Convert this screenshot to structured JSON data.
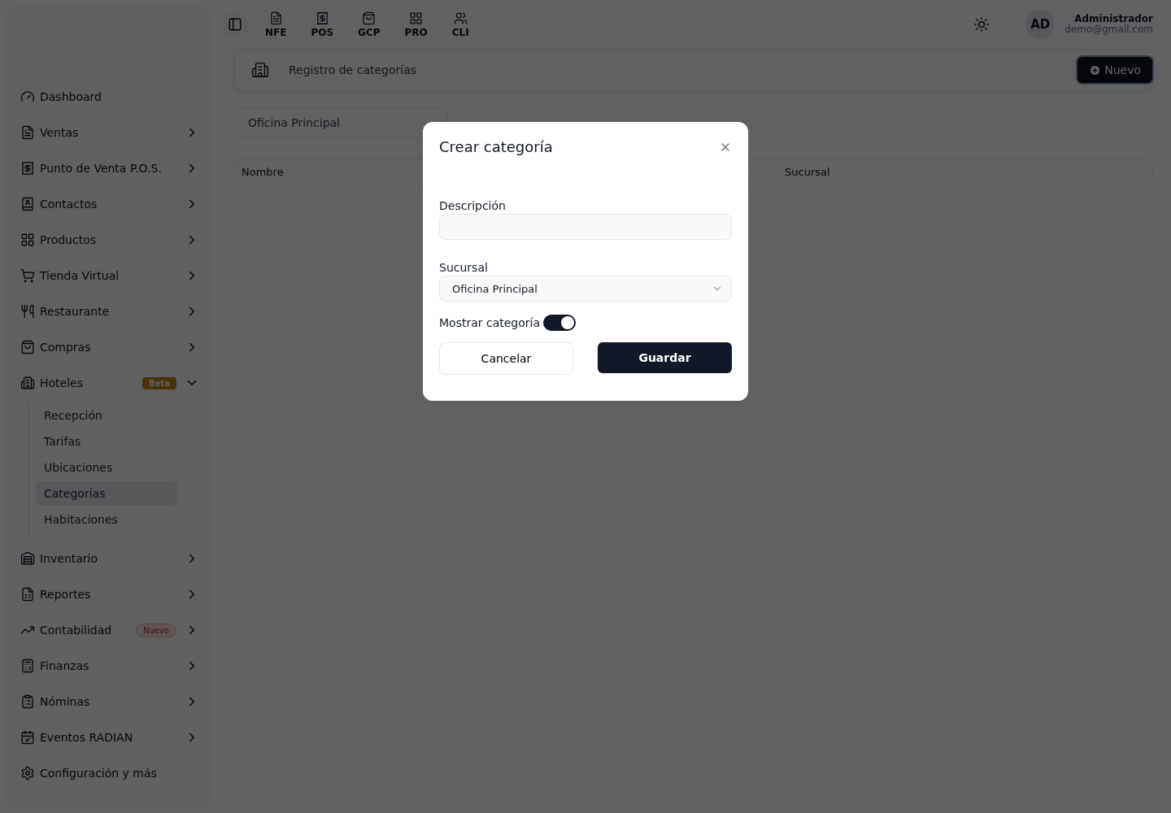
{
  "sidebar": {
    "items": [
      {
        "label": "Dashboard",
        "kind": "link"
      },
      {
        "label": "Ventas",
        "kind": "menu",
        "expanded": false
      },
      {
        "label": "Punto de Venta P.O.S.",
        "kind": "menu",
        "expanded": false
      },
      {
        "label": "Contactos",
        "kind": "menu",
        "expanded": false
      },
      {
        "label": "Productos",
        "kind": "menu",
        "expanded": false
      },
      {
        "label": "Tienda Virtual",
        "kind": "menu",
        "expanded": false
      },
      {
        "label": "Restaurante",
        "kind": "menu",
        "expanded": false
      },
      {
        "label": "Compras",
        "kind": "menu",
        "expanded": false
      },
      {
        "label": "Hoteles",
        "kind": "menu",
        "expanded": true,
        "badge": {
          "text": "Beta",
          "kind": "beta"
        },
        "children": [
          {
            "label": "Recepción",
            "selected": false
          },
          {
            "label": "Tarifas",
            "selected": false
          },
          {
            "label": "Ubicaciones",
            "selected": false
          },
          {
            "label": "Categorías",
            "selected": true
          },
          {
            "label": "Habitaciones",
            "selected": false
          }
        ]
      },
      {
        "label": "Inventario",
        "kind": "menu",
        "expanded": false
      },
      {
        "label": "Reportes",
        "kind": "menu",
        "expanded": false
      },
      {
        "label": "Contabilidad",
        "kind": "menu",
        "expanded": false,
        "badge": {
          "text": "Nuevo",
          "kind": "new"
        }
      },
      {
        "label": "Finanzas",
        "kind": "menu",
        "expanded": false
      },
      {
        "label": "Nóminas",
        "kind": "menu",
        "expanded": false
      },
      {
        "label": "Eventos RADIAN",
        "kind": "menu",
        "expanded": false
      },
      {
        "label": "Configuración y más",
        "kind": "link"
      }
    ]
  },
  "topbar": {
    "shortcuts": [
      "NFE",
      "POS",
      "GCP",
      "PRO",
      "CLI"
    ],
    "avatar": "AD",
    "user_name": "Administrador",
    "user_email": "demo@gmail.com"
  },
  "header": {
    "title": "Registro de categorías",
    "new_button": "Nuevo"
  },
  "branch_filter": {
    "value": "Oficina Principal"
  },
  "table": {
    "columns": [
      "Nombre",
      "Sucursal"
    ]
  },
  "modal": {
    "title": "Crear categoría",
    "description_label": "Descripción",
    "branch_label": "Sucursal",
    "branch_value": "Oficina Principal",
    "toggle_label": "Mostrar categoría",
    "toggle_on": true,
    "cancel": "Cancelar",
    "save": "Guardar"
  }
}
